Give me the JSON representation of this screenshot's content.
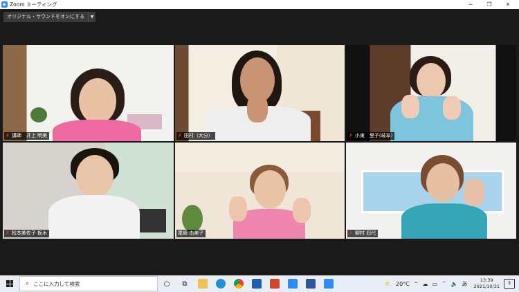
{
  "window": {
    "title": "Zoom ミーティング",
    "icon": "zoom-logo-icon",
    "controls": [
      "minimize-icon",
      "restore-icon",
      "close-icon"
    ]
  },
  "toolbar": {
    "original_sound_label": "オリジナル・サウンドをオンにする",
    "dropdown_icon": "chevron-down-icon"
  },
  "participants": [
    {
      "name": "講師　井上 明美",
      "muted": true,
      "active_speaker": true
    },
    {
      "name": "田村（大分）",
      "muted": true,
      "active_speaker": false
    },
    {
      "name": "小東　里子(岐阜)",
      "muted": true,
      "active_speaker": false
    },
    {
      "name": "松本美佐子 栃木",
      "muted": true,
      "active_speaker": false
    },
    {
      "name": "尾崎 由美子",
      "muted": false,
      "active_speaker": false
    },
    {
      "name": "柳村 旧代",
      "muted": true,
      "active_speaker": false
    }
  ],
  "colors": {
    "active_speaker_border": "#d7e64e",
    "mute_icon": "#e53935",
    "background": "#1a1a1a"
  },
  "taskbar": {
    "search_placeholder": "ここに入力して検索",
    "weather": "20°C",
    "ime": "あ",
    "time": "13:39",
    "date": "2021/10/31",
    "notification_count": "3"
  }
}
